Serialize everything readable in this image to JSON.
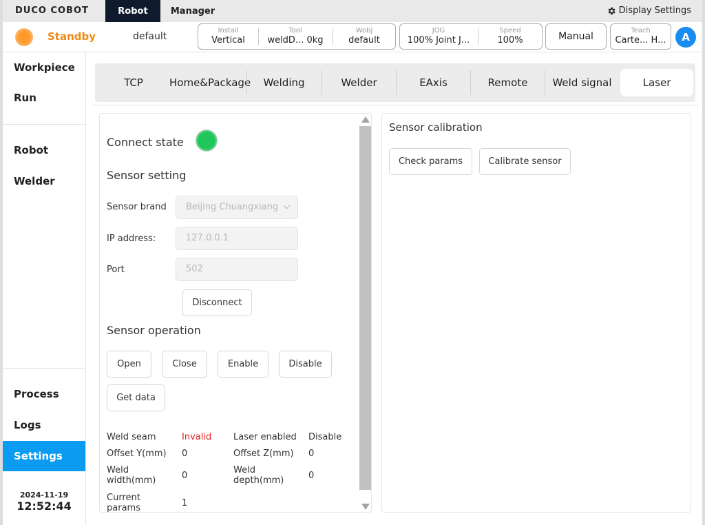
{
  "topbar": {
    "logo": "DUCO COBOT",
    "tabs": [
      "Robot",
      "Manager"
    ],
    "display_settings": "Display Settings"
  },
  "status": {
    "state": "Standby",
    "profile": "default",
    "install": {
      "caption": "Install",
      "value": "Vertical"
    },
    "tool": {
      "caption": "Tool",
      "value": "weldD...",
      "weight": "0kg"
    },
    "wobj": {
      "caption": "Wobj",
      "value": "default"
    },
    "jog": {
      "caption": "JOG",
      "value": "100% Joint J..."
    },
    "speed": {
      "caption": "Speed",
      "value": "100%"
    },
    "mode": "Manual",
    "teach": {
      "caption": "Teach",
      "value": "Carte... H..."
    },
    "avatar": "A",
    "colors": {
      "state": "#f08a14",
      "accent": "#0b9bf0"
    }
  },
  "sidebar": {
    "items": [
      "Workpiece",
      "Run",
      "Robot",
      "Welder",
      "Process",
      "Logs",
      "Settings"
    ],
    "active": "Settings",
    "date": "2024-11-19",
    "time": "12:52:44"
  },
  "subtabs": [
    "TCP",
    "Home&Package",
    "Welding",
    "Welder",
    "EAxis",
    "Remote",
    "Weld signal",
    "Laser"
  ],
  "active_subtab": "Laser",
  "laser": {
    "connect_state_label": "Connect state",
    "connect_color": "#1fc75a",
    "sensor_setting_title": "Sensor setting",
    "brand_label": "Sensor brand",
    "brand_value": "Beijing Chuangxiang",
    "ip_label": "IP address:",
    "ip_value": "127.0.0.1",
    "port_label": "Port",
    "port_value": "502",
    "disconnect": "Disconnect",
    "operation_title": "Sensor operation",
    "ops": [
      "Open",
      "Close",
      "Enable",
      "Disable"
    ],
    "get_data": "Get data",
    "weld_seam_label": "Weld seam",
    "weld_seam_value": "Invalid",
    "laser_enabled_label": "Laser enabled",
    "laser_enabled_value": "Disable",
    "offset_y_label": "Offset Y(mm)",
    "offset_y_value": "0",
    "offset_z_label": "Offset Z(mm)",
    "offset_z_value": "0",
    "weld_width_label": "Weld width(mm)",
    "weld_width_value": "0",
    "weld_depth_label": "Weld depth(mm)",
    "weld_depth_value": "0",
    "current_params_label": "Current params",
    "current_params_value": "1"
  },
  "calibration": {
    "title": "Sensor calibration",
    "check_params": "Check params",
    "calibrate_sensor": "Calibrate sensor"
  }
}
